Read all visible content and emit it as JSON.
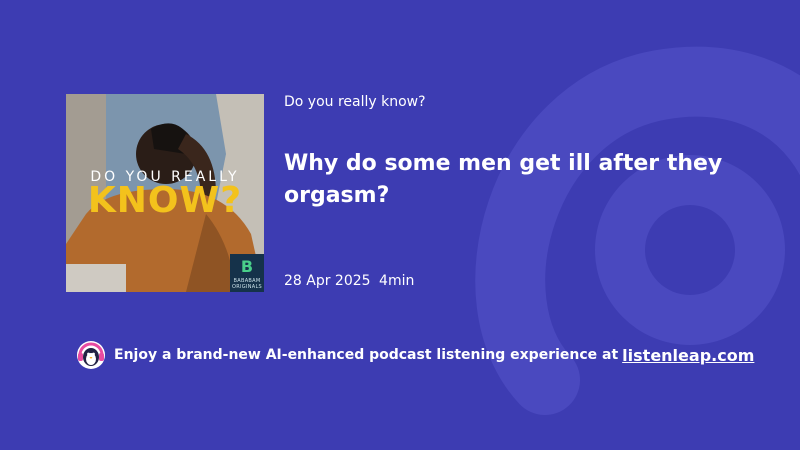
{
  "podcast": {
    "show_name": "Do you really know?",
    "episode_title": "Why do some men get ill after they orgasm?",
    "date": "28 Apr 2025",
    "duration": "4min",
    "artwork": {
      "line1": "DO YOU REALLY",
      "line2": "KNOW?",
      "badge_line1": "BABABAM",
      "badge_line2": "ORIGINALS"
    }
  },
  "promo": {
    "text": "Enjoy a brand-new AI-enhanced podcast listening experience at",
    "link_text": "listenleap.com",
    "mascot_icon": "penguin-headphones-icon"
  },
  "colors": {
    "background": "#3d3cb2",
    "art_yellow": "#f3c21c",
    "badge_green": "#49d08a"
  }
}
